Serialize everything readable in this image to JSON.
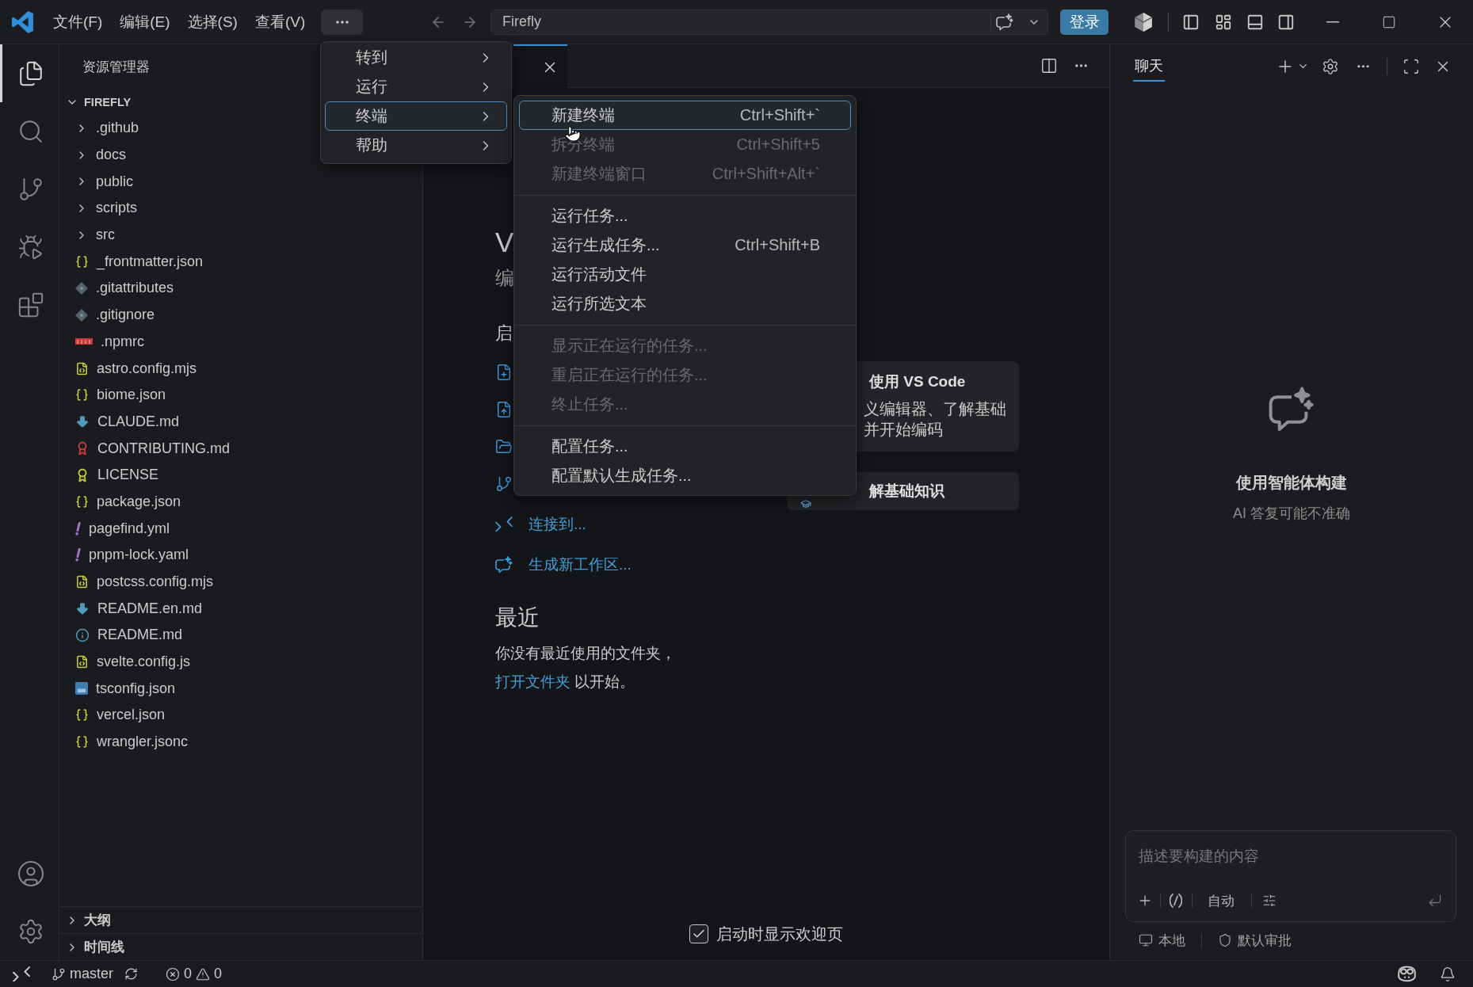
{
  "title_bar": {
    "menus": [
      "文件(F)",
      "编辑(E)",
      "选择(S)",
      "查看(V)"
    ],
    "overflow_menu_open": true,
    "command_center": {
      "text": "Firefly"
    },
    "sign_in_button": "登录"
  },
  "activity_bar": {
    "items": [
      {
        "kind": "explorer",
        "selected": true
      },
      {
        "kind": "search",
        "selected": false
      },
      {
        "kind": "source_control",
        "selected": false
      },
      {
        "kind": "run_debug",
        "selected": false
      },
      {
        "kind": "extensions",
        "selected": false
      }
    ]
  },
  "sidebar": {
    "title": "资源管理器",
    "root": {
      "name": "FIREFLY",
      "expanded": true,
      "children": [
        {
          "name": ".github",
          "kind": "folder",
          "expanded": false
        },
        {
          "name": "docs",
          "kind": "folder",
          "expanded": false
        },
        {
          "name": "public",
          "kind": "folder",
          "expanded": false
        },
        {
          "name": "scripts",
          "kind": "folder",
          "expanded": false
        },
        {
          "name": "src",
          "kind": "folder",
          "expanded": false
        },
        {
          "name": "_frontmatter.json",
          "kind": "json"
        },
        {
          "name": ".gitattributes",
          "kind": "git"
        },
        {
          "name": ".gitignore",
          "kind": "git"
        },
        {
          "name": ".npmrc",
          "kind": "npm"
        },
        {
          "name": "astro.config.mjs",
          "kind": "js"
        },
        {
          "name": "biome.json",
          "kind": "json"
        },
        {
          "name": "CLAUDE.md",
          "kind": "markdown"
        },
        {
          "name": "CONTRIBUTING.md",
          "kind": "contributing"
        },
        {
          "name": "LICENSE",
          "kind": "license"
        },
        {
          "name": "package.json",
          "kind": "json"
        },
        {
          "name": "pagefind.yml",
          "kind": "yaml"
        },
        {
          "name": "pnpm-lock.yaml",
          "kind": "yaml"
        },
        {
          "name": "postcss.config.mjs",
          "kind": "js"
        },
        {
          "name": "README.en.md",
          "kind": "markdown"
        },
        {
          "name": "README.md",
          "kind": "info"
        },
        {
          "name": "svelte.config.js",
          "kind": "js"
        },
        {
          "name": "tsconfig.json",
          "kind": "ts"
        },
        {
          "name": "vercel.json",
          "kind": "json"
        },
        {
          "name": "wrangler.jsonc",
          "kind": "json"
        }
      ]
    },
    "sections": [
      {
        "label": "大纲",
        "expanded": false
      },
      {
        "label": "时间线",
        "expanded": false
      }
    ]
  },
  "overflow_menu": {
    "items": [
      {
        "label": "转到",
        "selected": false
      },
      {
        "label": "运行",
        "selected": false
      },
      {
        "label": "终端",
        "selected": true
      },
      {
        "label": "帮助",
        "selected": false
      }
    ]
  },
  "terminal_submenu": {
    "groups": [
      {
        "items": [
          {
            "label": "新建终端",
            "shortcut": "Ctrl+Shift+`",
            "disabled": false,
            "selected": true
          },
          {
            "label": "拆分终端",
            "shortcut": "Ctrl+Shift+5",
            "disabled": true,
            "selected": false
          },
          {
            "label": "新建终端窗口",
            "shortcut": "Ctrl+Shift+Alt+`",
            "disabled": true,
            "selected": false
          }
        ]
      },
      {
        "items": [
          {
            "label": "运行任务...",
            "disabled": false,
            "selected": false
          },
          {
            "label": "运行生成任务...",
            "shortcut": "Ctrl+Shift+B",
            "disabled": false,
            "selected": false
          },
          {
            "label": "运行活动文件",
            "disabled": false,
            "selected": false
          },
          {
            "label": "运行所选文本",
            "disabled": false,
            "selected": false
          }
        ]
      },
      {
        "items": [
          {
            "label": "显示正在运行的任务...",
            "disabled": true,
            "selected": false
          },
          {
            "label": "重启正在运行的任务...",
            "disabled": true,
            "selected": false
          },
          {
            "label": "终止任务...",
            "disabled": true,
            "selected": false
          }
        ]
      },
      {
        "items": [
          {
            "label": "配置任务...",
            "disabled": false,
            "selected": false
          },
          {
            "label": "配置默认生成任务...",
            "disabled": false,
            "selected": false
          }
        ]
      }
    ]
  },
  "editor": {
    "tab": {
      "selected": true
    },
    "welcome": {
      "title_fragment": "V",
      "subtitle_fragment": "编",
      "start_heading_fragment": "启",
      "start_items": [
        {
          "kind": "new_file"
        },
        {
          "kind": "open_file"
        },
        {
          "kind": "open_folder"
        },
        {
          "kind": "clone"
        },
        {
          "kind": "connect",
          "label": "连接到..."
        },
        {
          "kind": "generate_workspace",
          "label": "生成新工作区..."
        }
      ],
      "recent": {
        "heading": "最近",
        "text": "你没有最近使用的文件夹，",
        "link": "打开文件夹",
        "suffix": "以开始。"
      },
      "walkthroughs": [
        {
          "title": "使用 VS Code",
          "description": [
            "义编辑器、了解基础",
            "并开始编码"
          ]
        },
        {
          "title": "解基础知识"
        }
      ],
      "show_on_startup": {
        "label": "启动时显示欢迎页",
        "checked": true
      }
    }
  },
  "chat": {
    "tabs": [
      {
        "label": "聊天",
        "selected": true
      }
    ],
    "empty_state": {
      "title": "使用智能体构建",
      "subtitle": "AI 答复可能不准确"
    },
    "input": {
      "placeholder": "描述要构建的内容"
    },
    "mode": "自动",
    "footer": [
      {
        "kind": "local",
        "label": "本地"
      },
      {
        "kind": "approval",
        "label": "默认审批"
      }
    ]
  },
  "status_bar": {
    "branch": "master",
    "errors": "0",
    "warnings": "0"
  }
}
